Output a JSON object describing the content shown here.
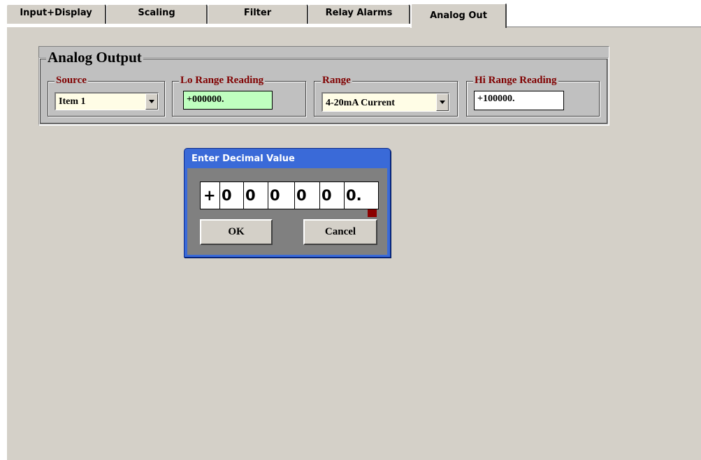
{
  "tabs": [
    {
      "label": "Input+Display",
      "active": false
    },
    {
      "label": "Scaling",
      "active": false
    },
    {
      "label": "Filter",
      "active": false
    },
    {
      "label": "Relay Alarms",
      "active": false
    },
    {
      "label": "Analog Out",
      "active": true
    }
  ],
  "analog_output": {
    "title": "Analog Output",
    "source": {
      "label": "Source",
      "value": "Item 1"
    },
    "lo_range": {
      "label": "Lo Range Reading",
      "value": "+000000."
    },
    "range": {
      "label": "Range",
      "value": "4-20mA Current"
    },
    "hi_range": {
      "label": "Hi Range Reading",
      "value": "+100000."
    }
  },
  "dialog": {
    "title": "Enter Decimal Value",
    "digits": [
      "+",
      "0",
      "0",
      "0",
      "0",
      "0",
      "0."
    ],
    "ok_label": "OK",
    "cancel_label": "Cancel"
  },
  "colors": {
    "tab_face": "#d4d0c8",
    "group_face": "#c0c0c0",
    "label_red": "#800000",
    "combo_bg": "#fffde6",
    "lo_field_bg": "#bfffbf",
    "hi_field_bg": "#ffffff",
    "dialog_blue": "#3a6ad8",
    "dialog_body": "#808080",
    "cursor_mark": "#8b0000"
  }
}
